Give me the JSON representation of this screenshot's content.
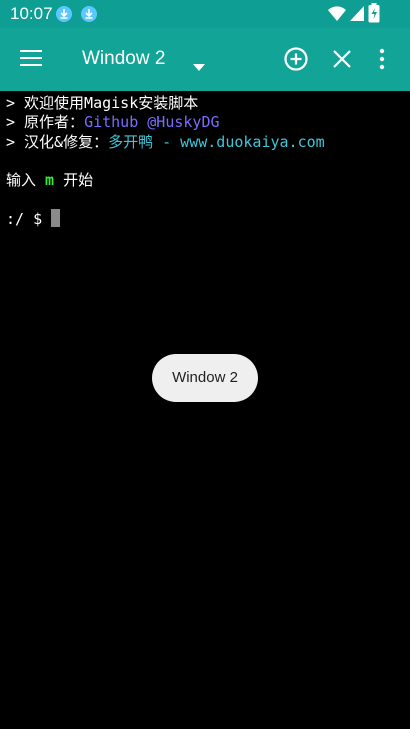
{
  "status_bar": {
    "time": "10:07",
    "icons": [
      "download-icon",
      "download-icon",
      "wifi-icon",
      "signal-icon",
      "battery-charging-icon"
    ]
  },
  "app_bar": {
    "title": "Window 2",
    "icons": [
      "menu-icon",
      "dropdown-icon",
      "add-icon",
      "close-icon",
      "more-icon"
    ]
  },
  "terminal": {
    "line1": "> 欢迎使用Magisk安装脚本",
    "line2_prefix": "> 原作者：",
    "line2_value": "Github @HuskyDG",
    "line3_prefix": "> 汉化&修复：",
    "line3_value": "多开鸭 - www.duokaiya.com",
    "line4_prefix": "输入 ",
    "line4_key": "m",
    "line4_suffix": " 开始",
    "prompt": ":/ $ "
  },
  "toast": {
    "text": "Window 2"
  },
  "colors": {
    "status_bar": "#0f9e93",
    "app_bar": "#12a597",
    "terminal_bg": "#000000",
    "link_blue": "#7a6cff",
    "link_cyan": "#3ec6d8",
    "key_green": "#39e83a",
    "toast_bg": "#efefef"
  }
}
